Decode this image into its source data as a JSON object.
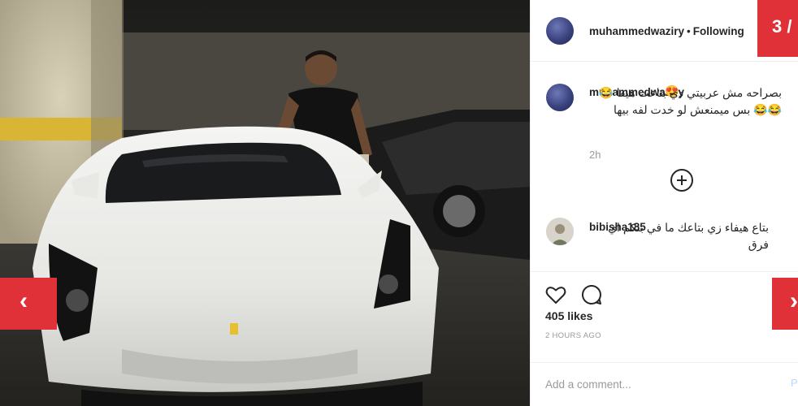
{
  "post": {
    "username": "muhammedwaziry",
    "separator": "•",
    "follow_status": "Following",
    "page_counter": "3 /",
    "caption": {
      "username": "muhammedwaziry",
      "emoji": "😍",
      "text": "بصراحه مش عربيتي دي بتاعت هيفا 😂😂😂 بس ميمنعش لو خدت لفه بيها",
      "time": "2h"
    },
    "comments": [
      {
        "username": "bibisha185",
        "text": "بتاع هيفاء زي بتاعك ما في بنكم اي فرق"
      }
    ],
    "likes": "405 likes",
    "time_ago": "2 HOURS AGO",
    "add_comment_placeholder": "Add a comment...",
    "post_label": "P",
    "nav": {
      "prev": "‹",
      "next": "›"
    }
  },
  "colors": {
    "accent": "#e03138",
    "text": "#262626",
    "muted": "#999999"
  },
  "icons": [
    "heart-icon",
    "comment-icon",
    "plus-circle-icon",
    "chevron-left-icon",
    "chevron-right-icon"
  ]
}
